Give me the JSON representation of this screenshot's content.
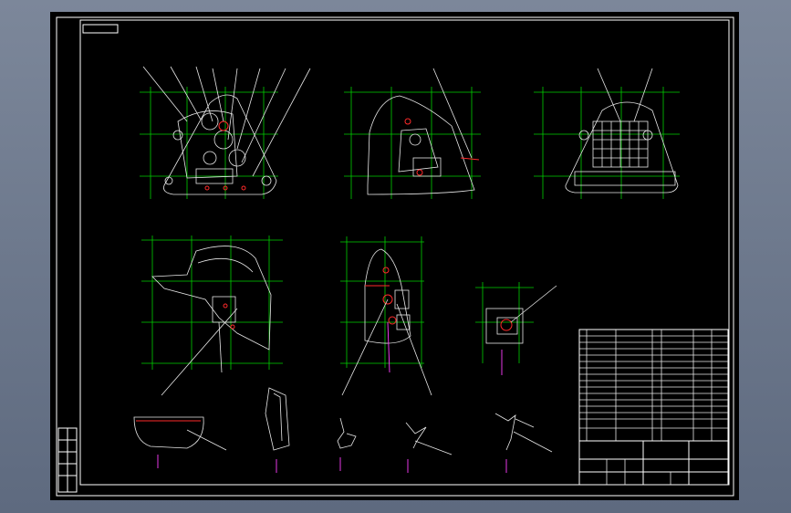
{
  "drawing": {
    "corner_label": "",
    "tech_req_title": "",
    "tech_requirements": [
      "",
      "",
      "",
      "",
      "",
      "",
      ""
    ]
  },
  "title_block": {
    "drawing_name": "",
    "drawing_number": ""
  }
}
